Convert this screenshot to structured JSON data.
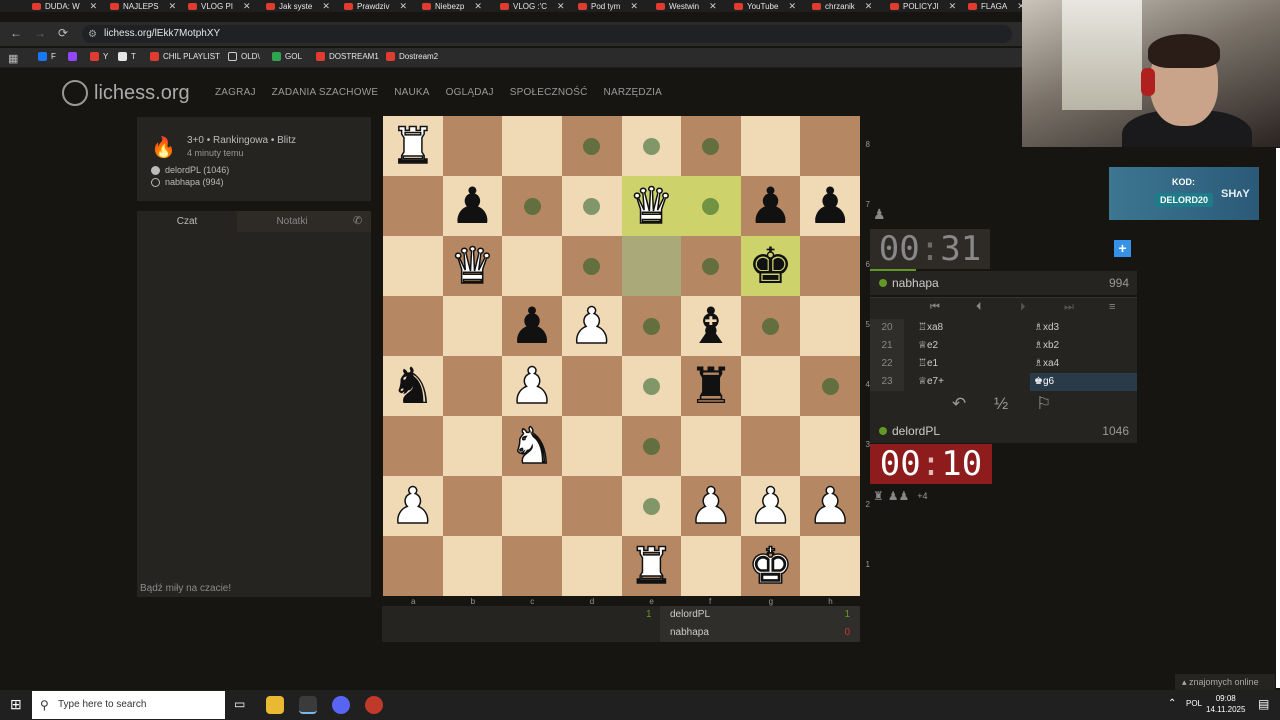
{
  "browser": {
    "tabs": [
      "DUDA: W",
      "NAJLEPS",
      "VLOG PI",
      "Jak syste",
      "Prawdziv",
      "Niebezp",
      "VLOG :'C",
      "Pod tym",
      "Westwin",
      "YouTube",
      "chrzanik",
      "POLICYJI",
      "FLAGA"
    ],
    "url": "lichess.org/lEkk7MotphXY",
    "bookmarks": [
      "F",
      "",
      "Y",
      "T",
      "CHIL PLAYLIST",
      "OLD\\",
      "GOL",
      "DOSTREAM1",
      "Dostream2"
    ]
  },
  "site": {
    "logo": "lichess.org",
    "nav": [
      "ZAGRAJ",
      "ZADANIA SZACHOWE",
      "NAUKA",
      "OGLĄDAJ",
      "SPOŁECZNOŚĆ",
      "NARZĘDZIA"
    ]
  },
  "game": {
    "mode": "3+0 • Rankingowa • Blitz",
    "when": "4 minuty temu",
    "white": "delordPL (1046)",
    "black": "nabhapa (994)"
  },
  "chat": {
    "tab_chat": "Czat",
    "tab_notes": "Notatki",
    "placeholder": "Bądź miły na czacie!"
  },
  "board": {
    "ranks": [
      "8",
      "7",
      "6",
      "5",
      "4",
      "3",
      "2",
      "1"
    ],
    "files": [
      "a",
      "b",
      "c",
      "d",
      "e",
      "f",
      "g",
      "h"
    ],
    "rows": [
      [
        "wR",
        "",
        "",
        "",
        "",
        "",
        "",
        ""
      ],
      [
        "",
        "bP",
        "",
        "",
        "wQ",
        "",
        "bP",
        "bP"
      ],
      [
        "",
        "wQ2",
        "",
        "",
        "",
        "",
        "bK",
        ""
      ],
      [
        "",
        "",
        "bP",
        "wP",
        "",
        "bB",
        "",
        ""
      ],
      [
        "bN",
        "",
        "wP",
        "",
        "",
        "bR",
        "",
        ""
      ],
      [
        "",
        "",
        "wN",
        "",
        "",
        "",
        "",
        ""
      ],
      [
        "wP",
        "",
        "",
        "",
        "",
        "wP",
        "wP",
        "wP"
      ],
      [
        "",
        "",
        "",
        "",
        "wR",
        "",
        "wK",
        ""
      ]
    ]
  },
  "scores": {
    "white_name": "delordPL",
    "white_score": "1",
    "black_name": "nabhapa",
    "black_score": "0",
    "left_score": "1"
  },
  "clocks": {
    "top_min": "00",
    "top_sec": "31",
    "bottom_min": "00",
    "bottom_sec": "10"
  },
  "players": {
    "top_name": "nabhapa",
    "top_rating": "994",
    "bottom_name": "delordPL",
    "bottom_rating": "1046"
  },
  "moves": [
    {
      "n": "20",
      "w": "♖xa8",
      "b": "♗xd3"
    },
    {
      "n": "21",
      "w": "♕e2",
      "b": "♗xb2"
    },
    {
      "n": "22",
      "w": "♖e1",
      "b": "♗xa4"
    },
    {
      "n": "23",
      "w": "♕e7+",
      "b": "♚g6"
    }
  ],
  "material_diff": "+4",
  "promo": {
    "kod": "KOD:",
    "code": "DELORD20",
    "brand": "SHʌY"
  },
  "friends": "znajomych online",
  "taskbar": {
    "search": "Type here to search",
    "lang": "POL",
    "time": "09:08",
    "date": "14.11.2025"
  }
}
